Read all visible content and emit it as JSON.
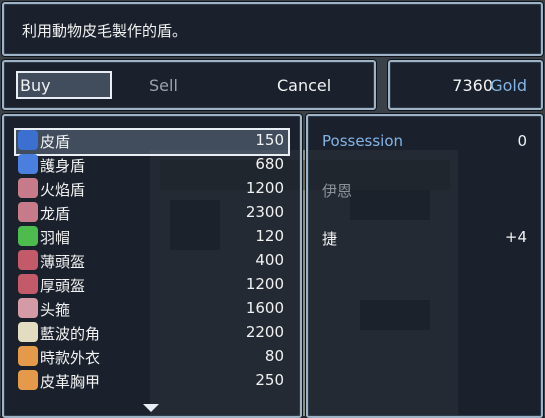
{
  "help": {
    "text": "利用動物皮毛製作的盾。"
  },
  "commands": {
    "buy": "Buy",
    "sell": "Sell",
    "cancel": "Cancel"
  },
  "gold": {
    "value": "7360",
    "unit": "Gold"
  },
  "items": [
    {
      "name": "皮盾",
      "price": "150",
      "icon": "shield-icon",
      "color": "#3b6fd0"
    },
    {
      "name": "護身盾",
      "price": "680",
      "icon": "shield-icon",
      "color": "#4a7fe0"
    },
    {
      "name": "火焰盾",
      "price": "1200",
      "icon": "round-shield-icon",
      "color": "#c77b8a"
    },
    {
      "name": "龙盾",
      "price": "2300",
      "icon": "round-shield-icon",
      "color": "#c77b8a"
    },
    {
      "name": "羽帽",
      "price": "120",
      "icon": "feather-hat-icon",
      "color": "#4dbb4d"
    },
    {
      "name": "薄頭盔",
      "price": "400",
      "icon": "helmet-icon",
      "color": "#c25a6a"
    },
    {
      "name": "厚頭盔",
      "price": "1200",
      "icon": "helmet-icon",
      "color": "#c25a6a"
    },
    {
      "name": "头箍",
      "price": "1600",
      "icon": "circlet-icon",
      "color": "#d49aa6"
    },
    {
      "name": "藍波的角",
      "price": "2200",
      "icon": "horn-icon",
      "color": "#e4dcc0"
    },
    {
      "name": "時款外衣",
      "price": "80",
      "icon": "clothes-icon",
      "color": "#e49a4a"
    },
    {
      "name": "皮革胸甲",
      "price": "250",
      "icon": "armor-icon",
      "color": "#e49a4a"
    }
  ],
  "status": {
    "possession_label": "Possession",
    "possession_value": "0",
    "actor_name": "伊恩",
    "param_label": "捷",
    "param_value": "+4"
  },
  "colors": {
    "system_blue": "#84b4e6",
    "window_border": "#9fb3c6"
  }
}
